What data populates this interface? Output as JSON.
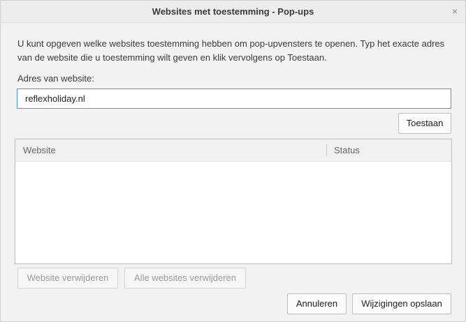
{
  "dialog": {
    "title": "Websites met toestemming - Pop-ups",
    "close_symbol": "×",
    "description": "U kunt opgeven welke websites toestemming hebben om pop-upvensters te openen. Typ het exacte adres van de website die u toestemming wilt geven en klik vervolgens op Toestaan.",
    "address_label": "Adres van website:",
    "address_value": "reflexholiday.nl",
    "allow_button": "Toestaan",
    "table": {
      "columns": [
        "Website",
        "Status"
      ],
      "rows": []
    },
    "remove_button": "Website verwijderen",
    "remove_all_button": "Alle websites verwijderen",
    "cancel_button": "Annuleren",
    "save_button": "Wijzigingen opslaan"
  }
}
